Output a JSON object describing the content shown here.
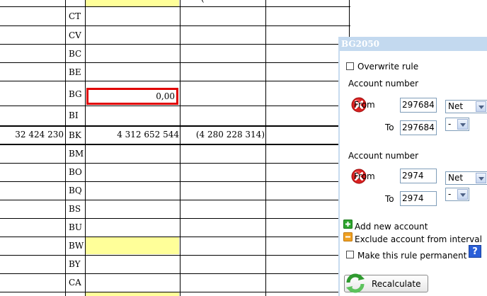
{
  "table": {
    "codes": [
      "CT",
      "CV",
      "BC",
      "BE",
      "BG",
      "BI",
      "BK",
      "BM",
      "BO",
      "BQ",
      "BS",
      "BU",
      "BW",
      "BY",
      "CA"
    ],
    "top_partial_text": "(",
    "bg_row_value": "0,00",
    "bk_row": {
      "col1": "32 424 230",
      "col3": "4 312 652 544",
      "col4": "(4 280 228 314)"
    }
  },
  "panel": {
    "title": "BG2050",
    "overwrite_rule_label": "Overwrite rule",
    "account_groups": [
      {
        "header": "Account number",
        "from_label": "From",
        "from_value": "297684",
        "from_select": "Net",
        "to_label": "To",
        "to_value": "297684",
        "to_select": "-"
      },
      {
        "header": "Account number",
        "from_label": "From",
        "from_value": "2974",
        "from_select": "Net",
        "to_label": "To",
        "to_value": "2974",
        "to_select": "-"
      }
    ],
    "add_account_label": "Add new account",
    "exclude_account_label": "Exclude account from interval",
    "permanent_rule_label": "Make this rule permanent",
    "help_glyph": "?",
    "recalculate_label": "Recalculate"
  },
  "colors": {
    "highlight_yellow": "#ffff99",
    "error_red": "#e00000",
    "panel_title_bg": "#c3d9ef",
    "add_green": "#2ea52e",
    "exclude_orange": "#f0a020",
    "help_blue": "#2a5fd8"
  },
  "icons": {
    "delete": "delete-x-icon",
    "add": "plus-icon",
    "exclude": "minus-icon",
    "help": "help-question-icon",
    "recalculate": "recalculate-arrows-icon"
  }
}
